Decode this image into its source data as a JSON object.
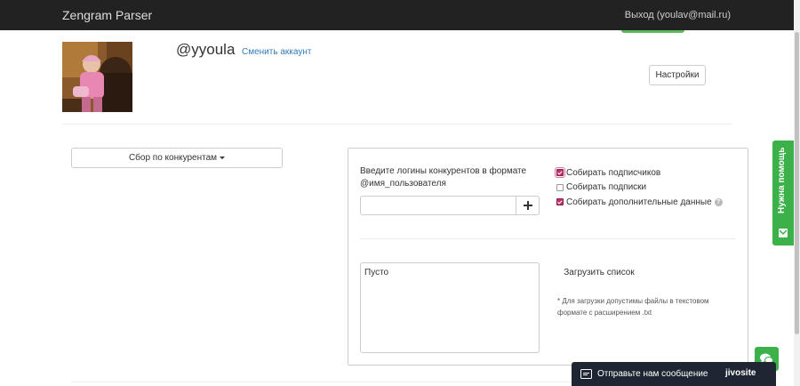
{
  "navbar": {
    "brand": "Zengram Parser",
    "logout": "Выход (youlav@mail.ru)"
  },
  "profile": {
    "username": "@yyoula",
    "switch_account": "Сменить аккаунт",
    "settings_button": "Настройки"
  },
  "collector": {
    "dropdown_label": "Сбор по конкурентам"
  },
  "panel": {
    "instructions": "Введите логины конкурентов в формате @имя_пользователя",
    "login_input_value": "",
    "options": [
      {
        "label": "Собирать подписчиков",
        "checked": true
      },
      {
        "label": "Собирать подписки",
        "checked": false
      },
      {
        "label": "Собирать дополнительные данные",
        "checked": true
      }
    ],
    "list_textarea": "Пусто",
    "upload_button": "Загрузить список",
    "upload_note": "* Для загрузки допустимы файлы в текстовом формате с расширением .txt"
  },
  "help_tab": {
    "label": "Нужна помощь"
  },
  "chat": {
    "message": "Отправьте нам сообщение",
    "brand": "jivosite"
  },
  "colors": {
    "navbar": "#222222",
    "accent_green": "#3cb14a",
    "link": "#337ab7",
    "chat_bar": "#1f2533"
  }
}
